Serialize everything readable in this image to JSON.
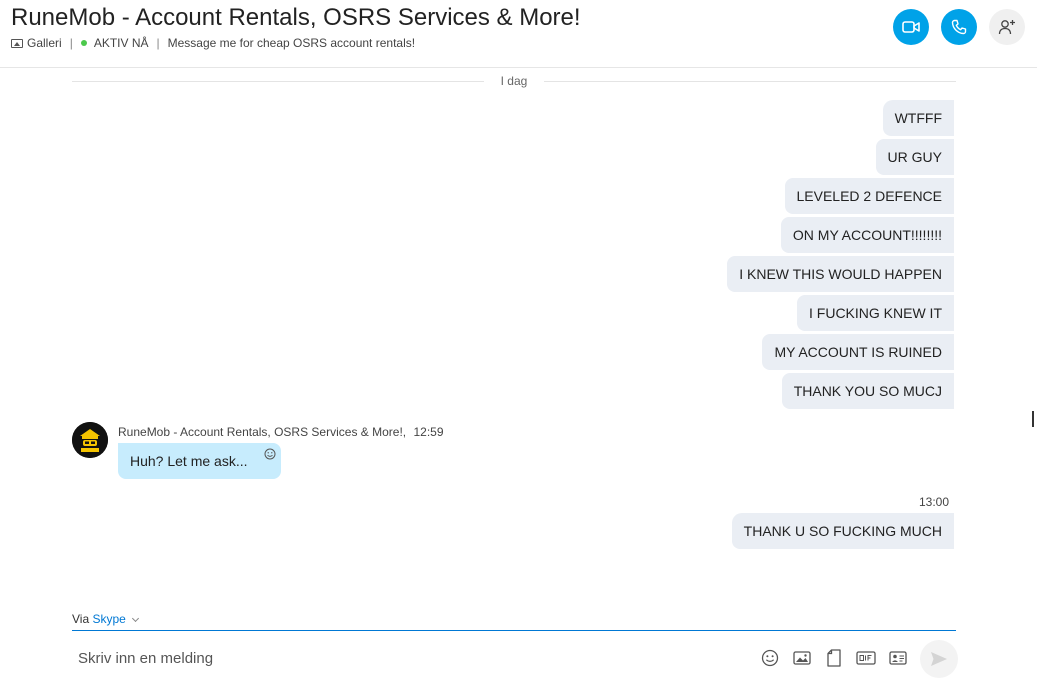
{
  "header": {
    "title": "RuneMob - Account Rentals, OSRS Services & More!",
    "gallery_label": "Galleri",
    "sep": "|",
    "status": "AKTIV NÅ",
    "mood": "Message me for cheap OSRS account rentals!",
    "buttons": {
      "video_icon": "video-camera-icon",
      "call_icon": "phone-icon",
      "add_icon": "add-person-icon"
    }
  },
  "conversation": {
    "day_divider": "I dag",
    "outgoing_group_1": [
      "WTFFF",
      "UR GUY",
      "LEVELED 2 DEFENCE",
      "ON MY ACCOUNT!!!!!!!!",
      "I KNEW THIS WOULD HAPPEN",
      "I FUCKING KNEW IT",
      "MY ACCOUNT IS RUINED",
      "THANK YOU SO MUCJ"
    ],
    "incoming": {
      "sender": "RuneMob - Account Rentals, OSRS Services & More!,",
      "time": "12:59",
      "text": "Huh? Let me ask..."
    },
    "outgoing_group_2": {
      "time": "13:00",
      "messages": [
        "THANK U SO FUCKING MUCH"
      ]
    }
  },
  "composer": {
    "via_label": "Via",
    "via_link": "Skype",
    "placeholder": "Skriv inn en melding",
    "tools": [
      "emoji-icon",
      "image-icon",
      "file-icon",
      "gif-icon",
      "contact-card-icon"
    ],
    "send_icon": "send-icon"
  },
  "colors": {
    "accent": "#00a2e8",
    "link": "#0078d4",
    "outgoing_bubble": "#eaeef4",
    "incoming_bubble": "#c7ecfd",
    "online": "#4cc94c"
  }
}
